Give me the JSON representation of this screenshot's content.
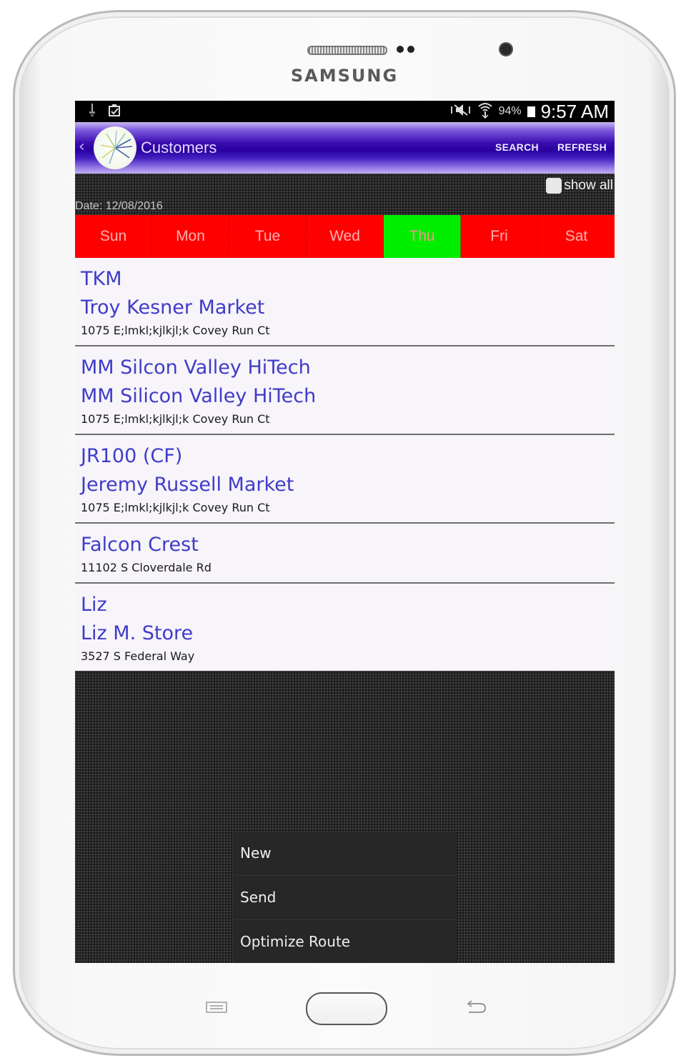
{
  "device": {
    "brand": "SAMSUNG"
  },
  "status_bar": {
    "icons": [
      "usb-debug-icon",
      "clipboard-check-icon",
      "mute-icon",
      "wifi-icon",
      "battery-icon"
    ],
    "battery_percent": "94%",
    "time": "9:57 AM"
  },
  "action_bar": {
    "back_glyph": "‹",
    "title": "Customers",
    "search_label": "SEARCH",
    "refresh_label": "REFRESH",
    "accent_color": "#2a00a0"
  },
  "filter": {
    "show_all_label": "show all",
    "show_all_checked": false,
    "date_label": "Date: 12/08/2016"
  },
  "days": {
    "items": [
      {
        "label": "Sun",
        "active": false
      },
      {
        "label": "Mon",
        "active": false
      },
      {
        "label": "Tue",
        "active": false
      },
      {
        "label": "Wed",
        "active": false
      },
      {
        "label": "Thu",
        "active": true
      },
      {
        "label": "Fri",
        "active": false
      },
      {
        "label": "Sat",
        "active": false
      }
    ],
    "inactive_color": "#ff0000",
    "active_color": "#00ee00"
  },
  "customers": [
    {
      "lines": [
        "TKM",
        "Troy Kesner Market"
      ],
      "address": "1075 E;lmkl;kjlkjl;k Covey Run Ct"
    },
    {
      "lines": [
        "MM Silcon Valley HiTech",
        "MM Silicon Valley HiTech"
      ],
      "address": "1075 E;lmkl;kjlkjl;k Covey Run Ct"
    },
    {
      "lines": [
        "JR100 (CF)",
        "Jeremy Russell Market"
      ],
      "address": "1075 E;lmkl;kjlkjl;k Covey Run Ct"
    },
    {
      "lines": [
        "Falcon Crest"
      ],
      "address": "11102 S Cloverdale Rd"
    },
    {
      "lines": [
        "Liz",
        "Liz M. Store"
      ],
      "address": "3527 S Federal Way"
    }
  ],
  "overflow_menu": {
    "items": [
      "New",
      "Send",
      "Optimize Route"
    ]
  },
  "hardware_keys": [
    "menu-key",
    "home-key",
    "back-key"
  ]
}
